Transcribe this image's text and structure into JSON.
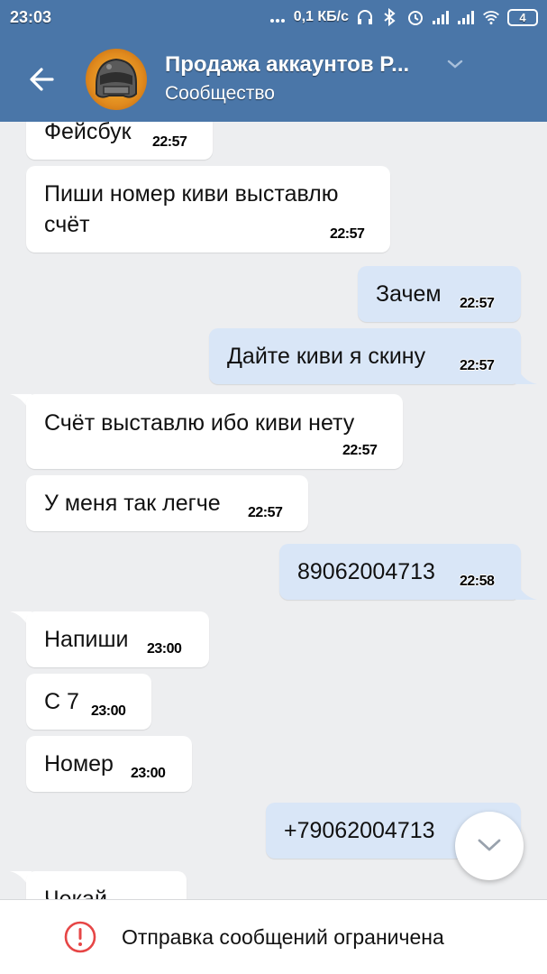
{
  "status_bar": {
    "time": "23:03",
    "network_speed": "0,1 КБ/с",
    "battery_level": "4",
    "icons": [
      "dots-icon",
      "headphones-icon",
      "bluetooth-icon",
      "alarm-icon",
      "signal-icon",
      "signal-icon",
      "wifi-icon",
      "battery-icon"
    ]
  },
  "header": {
    "title": "Продажа аккаунтов P...",
    "subtitle": "Сообщество",
    "back_icon": "arrow-left-icon",
    "dropdown_icon": "chevron-down-icon",
    "accent_color": "#4a76a8"
  },
  "messages": [
    {
      "direction": "in",
      "text": "Фейсбук",
      "time": "22:57"
    },
    {
      "direction": "in",
      "text_line1": "Пиши номер киви выставлю",
      "text_line2": "счёт",
      "time": "22:57"
    },
    {
      "direction": "out",
      "text": "Зачем",
      "time": "22:57"
    },
    {
      "direction": "out",
      "text": "Дайте киви я скину",
      "time": "22:57"
    },
    {
      "direction": "in",
      "text": "Счёт выставлю ибо киви нету",
      "time": "22:57"
    },
    {
      "direction": "in",
      "text": "У меня так легче",
      "time": "22:57"
    },
    {
      "direction": "out",
      "text": "89062004713",
      "time": "22:58"
    },
    {
      "direction": "in",
      "text": "Напиши",
      "time": "23:00"
    },
    {
      "direction": "in",
      "text": "С 7",
      "time": "23:00"
    },
    {
      "direction": "in",
      "text": "Номер",
      "time": "23:00"
    },
    {
      "direction": "out",
      "text": "+79062004713",
      "time": ""
    },
    {
      "direction": "in",
      "text": "Чекай",
      "time": ""
    }
  ],
  "colors": {
    "incoming_bubble": "#ffffff",
    "outgoing_bubble": "#d9e6f7",
    "chat_background": "#edeef0",
    "warning_red": "#e64646"
  },
  "scroll_button": {
    "icon": "chevron-down-icon"
  },
  "footer": {
    "icon": "alert-circle-icon",
    "text": "Отправка сообщений ограничена"
  }
}
